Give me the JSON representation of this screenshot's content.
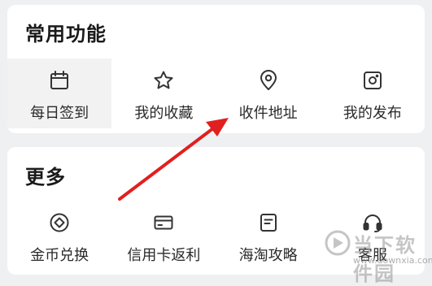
{
  "sections": {
    "common": {
      "title": "常用功能",
      "items": [
        {
          "label": "每日签到",
          "icon": "calendar-icon"
        },
        {
          "label": "我的收藏",
          "icon": "star-icon"
        },
        {
          "label": "收件地址",
          "icon": "location-pin-icon"
        },
        {
          "label": "我的发布",
          "icon": "publish-icon"
        }
      ]
    },
    "more": {
      "title": "更多",
      "items": [
        {
          "label": "金币兑换",
          "icon": "coin-icon"
        },
        {
          "label": "信用卡返利",
          "icon": "credit-card-icon"
        },
        {
          "label": "海淘攻略",
          "icon": "document-icon"
        },
        {
          "label": "客服",
          "icon": "headset-icon"
        }
      ]
    }
  },
  "annotation": {
    "color": "#e02020",
    "points_to": "收件地址"
  },
  "watermark": {
    "title": "当下软件园",
    "url": "www.downxia.com"
  },
  "colors": {
    "background": "#eef0f2",
    "card": "#ffffff",
    "highlight": "#f2f2f2"
  }
}
